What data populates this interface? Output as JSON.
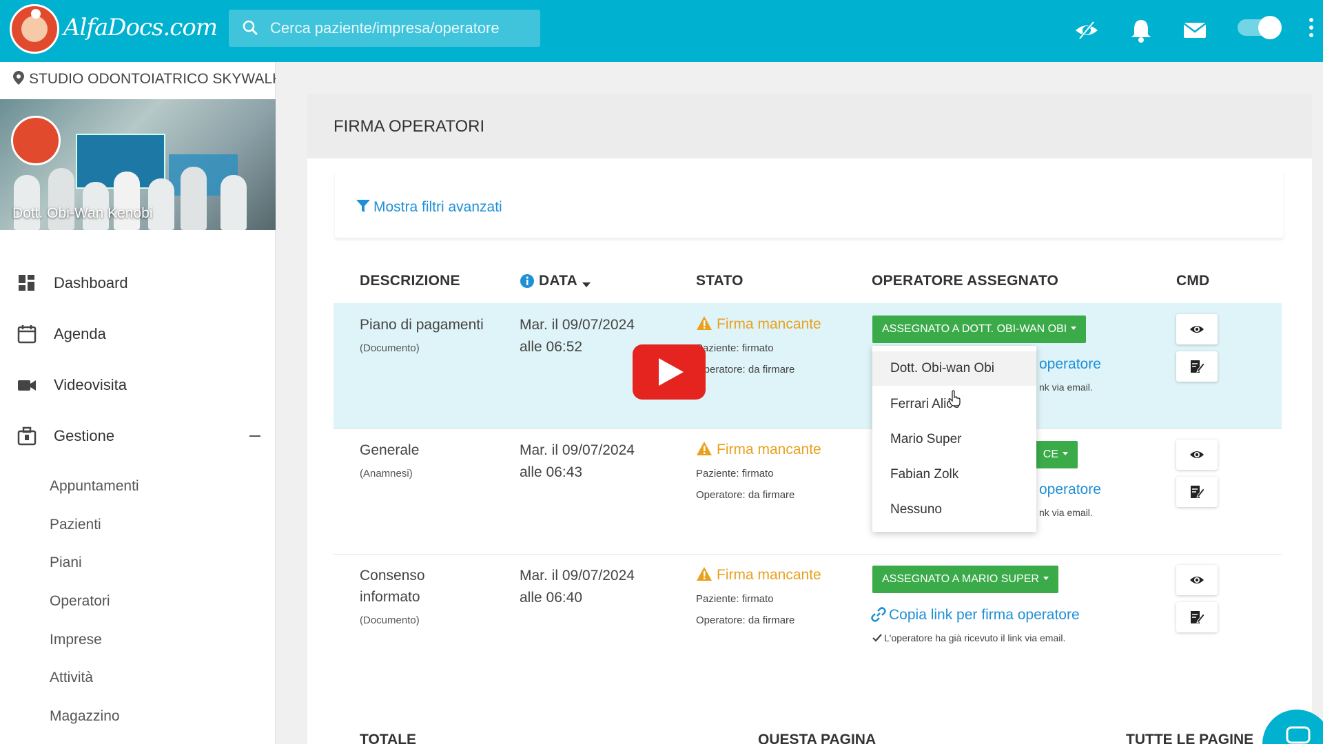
{
  "header": {
    "logo_text": "AlfaDocs.com",
    "search_placeholder": "Cerca paziente/impresa/operatore"
  },
  "sidebar": {
    "location": "STUDIO ODONTOIATRICO SKYWALKER",
    "profile_name": "Dott. Obi-Wan Kenobi",
    "nav": [
      {
        "label": "Dashboard",
        "icon": "dashboard-icon"
      },
      {
        "label": "Agenda",
        "icon": "calendar-icon"
      },
      {
        "label": "Videovisita",
        "icon": "video-camera-icon"
      },
      {
        "label": "Gestione",
        "icon": "briefcase-icon"
      }
    ],
    "sub_items": [
      "Appuntamenti",
      "Pazienti",
      "Piani",
      "Operatori",
      "Imprese",
      "Attività",
      "Magazzino"
    ]
  },
  "page": {
    "title": "FIRMA OPERATORI",
    "filters_link": "Mostra filtri avanzati"
  },
  "table": {
    "headers": {
      "descrizione": "DESCRIZIONE",
      "data": "DATA",
      "stato": "STATO",
      "operatore": "OPERATORE ASSEGNATO",
      "cmd": "CMD"
    },
    "rows": [
      {
        "desc": "Piano di pagamenti",
        "type": "(Documento)",
        "date_line1": "Mar. il 09/07/2024",
        "date_line2": "alle 06:52",
        "status": "Firma mancante",
        "paziente": "Paziente: firmato",
        "operatore": "Operatore: da firmare",
        "assign_label": "ASSEGNATO A DOTT. OBI-WAN OBI",
        "link_fragment": "operatore",
        "note_fragment": "nk via email."
      },
      {
        "desc": "Generale",
        "type": "(Anamnesi)",
        "date_line1": "Mar. il 09/07/2024",
        "date_line2": "alle 06:43",
        "status": "Firma mancante",
        "paziente": "Paziente: firmato",
        "operatore": "Operatore: da firmare",
        "assign_fragment": "CE",
        "link_fragment": "operatore",
        "note_fragment": "nk via email."
      },
      {
        "desc_line1": "Consenso",
        "desc_line2": "informato",
        "type": "(Documento)",
        "date_line1": "Mar. il 09/07/2024",
        "date_line2": "alle 06:40",
        "status": "Firma mancante",
        "paziente": "Paziente: firmato",
        "operatore": "Operatore: da firmare",
        "assign_label": "ASSEGNATO A MARIO SUPER",
        "link_label": "Copia link per firma operatore",
        "note": "L'operatore ha già ricevuto il link via email."
      }
    ]
  },
  "dropdown": {
    "options": [
      "Dott. Obi-wan Obi",
      "Ferrari Alice",
      "Mario Super",
      "Fabian Zolk",
      "Nessuno"
    ],
    "selected": "Dott. Obi-wan Obi"
  },
  "footer": {
    "totale": "TOTALE",
    "questa_pagina": "QUESTA PAGINA",
    "tutte_le_pagine": "TUTTE LE PAGINE"
  },
  "colors": {
    "brand": "#00b1d0",
    "link": "#1f8fd6",
    "warning": "#e8a01d",
    "success": "#3bab4a",
    "row_highlight": "#dff4f8"
  }
}
